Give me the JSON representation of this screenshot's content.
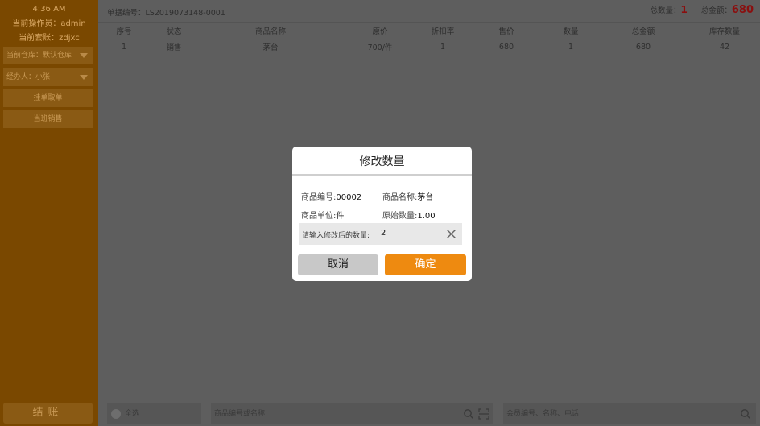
{
  "sidebar": {
    "time": "4:36 AM",
    "operator": "当前操作员：admin",
    "package": "当前套账：zdjxc",
    "warehouse": "当前仓库：默认仓库",
    "handler": "经办人：小张",
    "hold_order": "挂单取单",
    "current_class": "当班销售",
    "checkout": "结账"
  },
  "header": {
    "order_no": "单据编号：LS2019073148-0001",
    "total_qty_label": "总数量：",
    "total_qty": "1",
    "total_amount_label": "总金额：",
    "total_amount": "680"
  },
  "table": {
    "columns": [
      "序号",
      "状态",
      "商品名称",
      "原价",
      "折扣率",
      "售价",
      "数量",
      "总金额",
      "库存数量"
    ],
    "rows": [
      [
        "1",
        "销售",
        "茅台",
        "700/件",
        "1",
        "680",
        "1",
        "680",
        "42"
      ]
    ]
  },
  "bottom": {
    "select_all": "全选",
    "product_search_placeholder": "商品编号或名称",
    "member_search_placeholder": "会员编号、名称、电话"
  },
  "modal": {
    "title": "修改数量",
    "code_label": "商品编号:",
    "code": "00002",
    "name_label": "商品名称:",
    "name": "茅台",
    "unit_label": "商品单位:",
    "unit": "件",
    "orig_qty_label": "原始数量:",
    "orig_qty": "1.00",
    "input_label": "请输入修改后的数量:",
    "input_value": "2",
    "cancel": "取消",
    "confirm": "确定"
  },
  "colors": {
    "accent": "#ee8a10",
    "sidebar_bg": "#7a4800",
    "highlight": "#8a0f0f"
  }
}
